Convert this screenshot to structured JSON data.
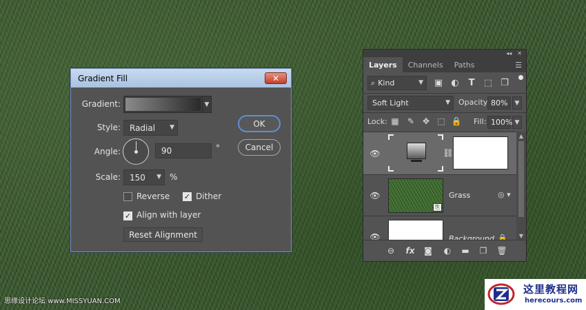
{
  "dialog": {
    "title": "Gradient Fill",
    "close_label": "✕",
    "gradient_label": "Gradient:",
    "style_label": "Style:",
    "style_value": "Radial",
    "angle_label": "Angle:",
    "angle_value": "90",
    "angle_unit": "°",
    "scale_label": "Scale:",
    "scale_value": "150",
    "scale_unit": "%",
    "reverse_label": "Reverse",
    "reverse_checked": false,
    "dither_label": "Dither",
    "dither_checked": true,
    "align_label": "Align with layer",
    "align_checked": true,
    "reset_label": "Reset Alignment",
    "ok_label": "OK",
    "cancel_label": "Cancel"
  },
  "layers_panel": {
    "tabs": [
      "Layers",
      "Channels",
      "Paths"
    ],
    "active_tab": "Layers",
    "kind_label": "Kind",
    "blend_mode": "Soft Light",
    "opacity_label": "Opacity:",
    "opacity_value": "80%",
    "lock_label": "Lock:",
    "fill_label": "Fill:",
    "fill_value": "100%",
    "layers": [
      {
        "name": "",
        "type": "gradient-fill",
        "selected": true,
        "visible": true
      },
      {
        "name": "Grass",
        "type": "smart-object",
        "selected": false,
        "visible": true
      },
      {
        "name": "Background",
        "type": "background",
        "selected": false,
        "visible": true
      }
    ]
  },
  "watermark": {
    "left_text": "思缘设计论坛 www.MISSYUAN.COM"
  },
  "logo": {
    "chinese_text": "这里教程网",
    "url_text": "herecours.com"
  },
  "colors": {
    "dialog_bg": "#535353",
    "titlebar": "#b9cfe9",
    "ok_border": "#5b8fd6",
    "close_button": "#c9503a",
    "logo_blue": "#1e2f8a"
  }
}
